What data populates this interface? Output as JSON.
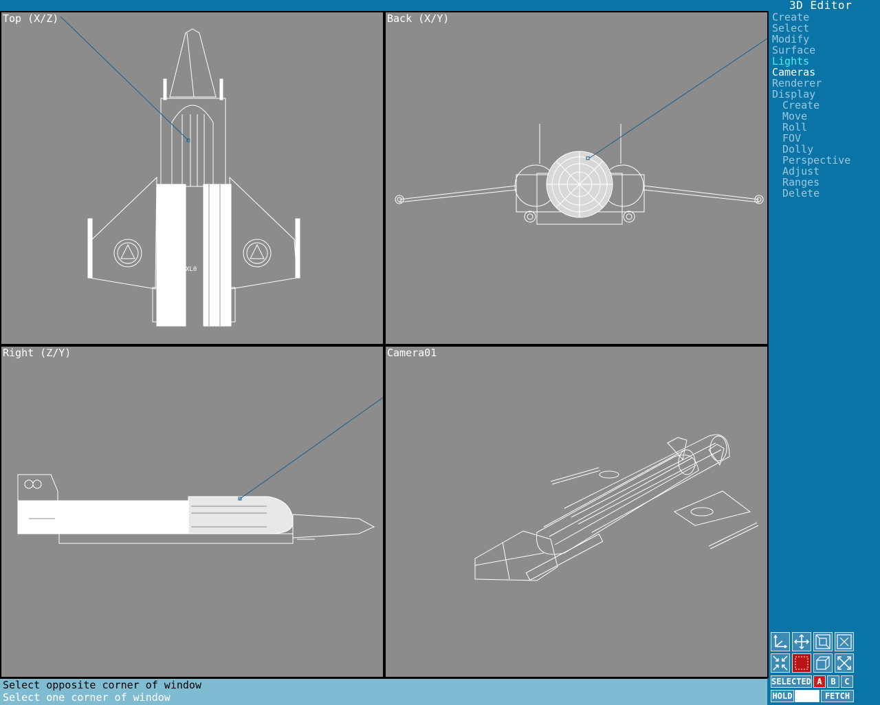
{
  "app": {
    "title": "3D Editor"
  },
  "viewports": {
    "top": {
      "label": "Top (X/Z)"
    },
    "back": {
      "label": "Back (X/Y)"
    },
    "right": {
      "label": "Right (Z/Y)"
    },
    "camera": {
      "label": "Camera01"
    }
  },
  "menu": {
    "items": [
      {
        "label": "Create"
      },
      {
        "label": "Select"
      },
      {
        "label": "Modify"
      },
      {
        "label": "Surface"
      },
      {
        "label": "Lights"
      },
      {
        "label": "Cameras"
      },
      {
        "label": "Renderer"
      },
      {
        "label": "Display"
      }
    ],
    "submenu": [
      {
        "label": "Create"
      },
      {
        "label": "Move"
      },
      {
        "label": "Roll"
      },
      {
        "label": "FOV"
      },
      {
        "label": "Dolly"
      },
      {
        "label": "Perspective"
      },
      {
        "label": "Adjust"
      },
      {
        "label": "Ranges"
      },
      {
        "label": "Delete"
      }
    ]
  },
  "status": {
    "line1": "Select opposite corner of window",
    "line2": "Select one corner of window"
  },
  "toolbar": {
    "selected_label": "SELECTED",
    "sel_a": "A",
    "sel_b": "B",
    "sel_c": "C",
    "hold_label": "HOLD",
    "fetch_label": "FETCH"
  },
  "colors": {
    "background": "#0a74a6",
    "viewport": "#8c8c8c",
    "menu_text": "#9ec8e0",
    "menu_active": "#49f2f2",
    "status_bar": "#7fbcd2"
  }
}
